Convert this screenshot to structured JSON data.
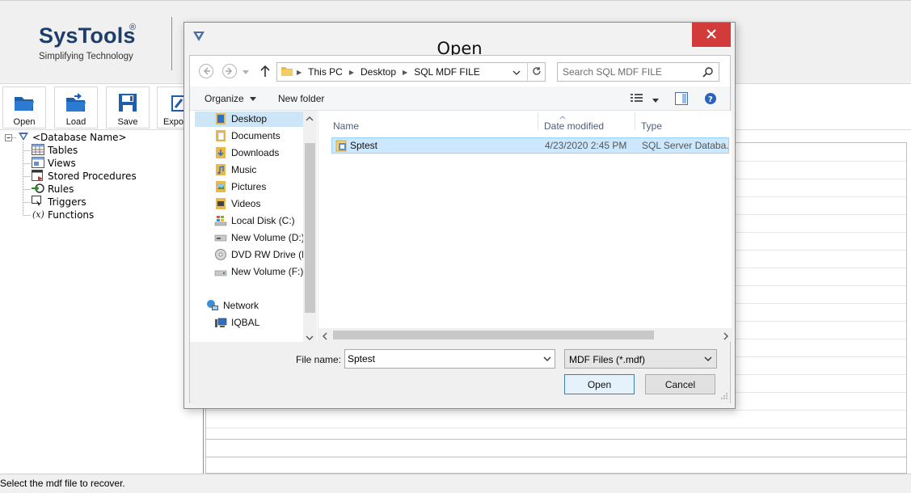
{
  "app": {
    "logo_title": "SysTools",
    "logo_reg": "®",
    "logo_tagline": "Simplifying Technology",
    "toolbar": [
      {
        "label": "Open",
        "icon": "folder-open-icon"
      },
      {
        "label": "Load",
        "icon": "folder-load-icon"
      },
      {
        "label": "Save",
        "icon": "save-icon"
      },
      {
        "label": "Expo",
        "icon": "export-icon"
      }
    ],
    "tree": {
      "root": "<Database Name>",
      "children": [
        "Tables",
        "Views",
        "Stored Procedures",
        "Rules",
        "Triggers",
        "Functions"
      ]
    },
    "status": "Select the mdf file to recover."
  },
  "dialog": {
    "title": "Open",
    "breadcrumbs": [
      "This PC",
      "Desktop",
      "SQL MDF FILE"
    ],
    "search_placeholder": "Search SQL MDF FILE",
    "organize_label": "Organize",
    "new_folder_label": "New folder",
    "nav_items": [
      {
        "label": "Desktop",
        "icon": "folder-icon",
        "selected": true
      },
      {
        "label": "Documents",
        "icon": "documents-folder-icon"
      },
      {
        "label": "Downloads",
        "icon": "downloads-folder-icon"
      },
      {
        "label": "Music",
        "icon": "music-folder-icon"
      },
      {
        "label": "Pictures",
        "icon": "pictures-folder-icon"
      },
      {
        "label": "Videos",
        "icon": "videos-folder-icon"
      },
      {
        "label": "Local Disk (C:)",
        "icon": "local-disk-icon"
      },
      {
        "label": "New Volume (D:)",
        "icon": "drive-icon"
      },
      {
        "label": "DVD RW Drive (E:",
        "icon": "dvd-drive-icon"
      },
      {
        "label": "New Volume (F:)",
        "icon": "drive-icon"
      },
      {
        "label": "Network",
        "icon": "network-icon"
      },
      {
        "label": "IQBAL",
        "icon": "computer-icon"
      }
    ],
    "columns": [
      "Name",
      "Date modified",
      "Type"
    ],
    "files": [
      {
        "name": "Sptest",
        "date": "4/23/2020 2:45 PM",
        "type": "SQL Server Databa..."
      }
    ],
    "file_name_label": "File name:",
    "file_name_value": "Sptest",
    "file_type": "MDF Files (*.mdf)",
    "open_label": "Open",
    "cancel_label": "Cancel",
    "colors": {
      "close_button": "#d33a3a",
      "selection": "#cce8ff"
    }
  }
}
